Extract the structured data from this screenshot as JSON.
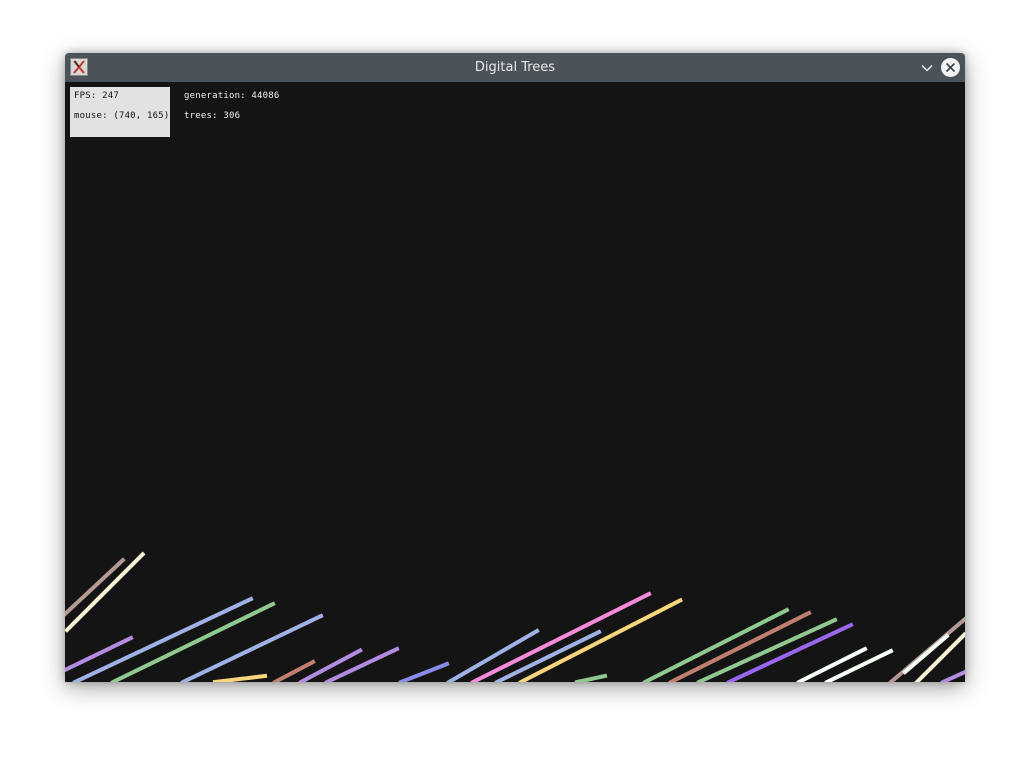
{
  "window": {
    "title": "Digital Trees",
    "icon": "app-icon",
    "controls": [
      "minimize-icon",
      "close-icon"
    ]
  },
  "hud": {
    "fps": "FPS: 247",
    "mouse": "mouse: (740, 165)",
    "generation": "generation: 44086",
    "trees": "trees: 306"
  },
  "colors": {
    "background": "#141414",
    "titlebar": "#4b5358",
    "tree_palette": [
      "#b49a93",
      "#f3f0d2",
      "#b28ce0",
      "#9fb2e6",
      "#8fc98f",
      "#f68ae0",
      "#f7d57a",
      "#8a8be6",
      "#c08070",
      "#f5fff7",
      "#9966ee"
    ]
  }
}
